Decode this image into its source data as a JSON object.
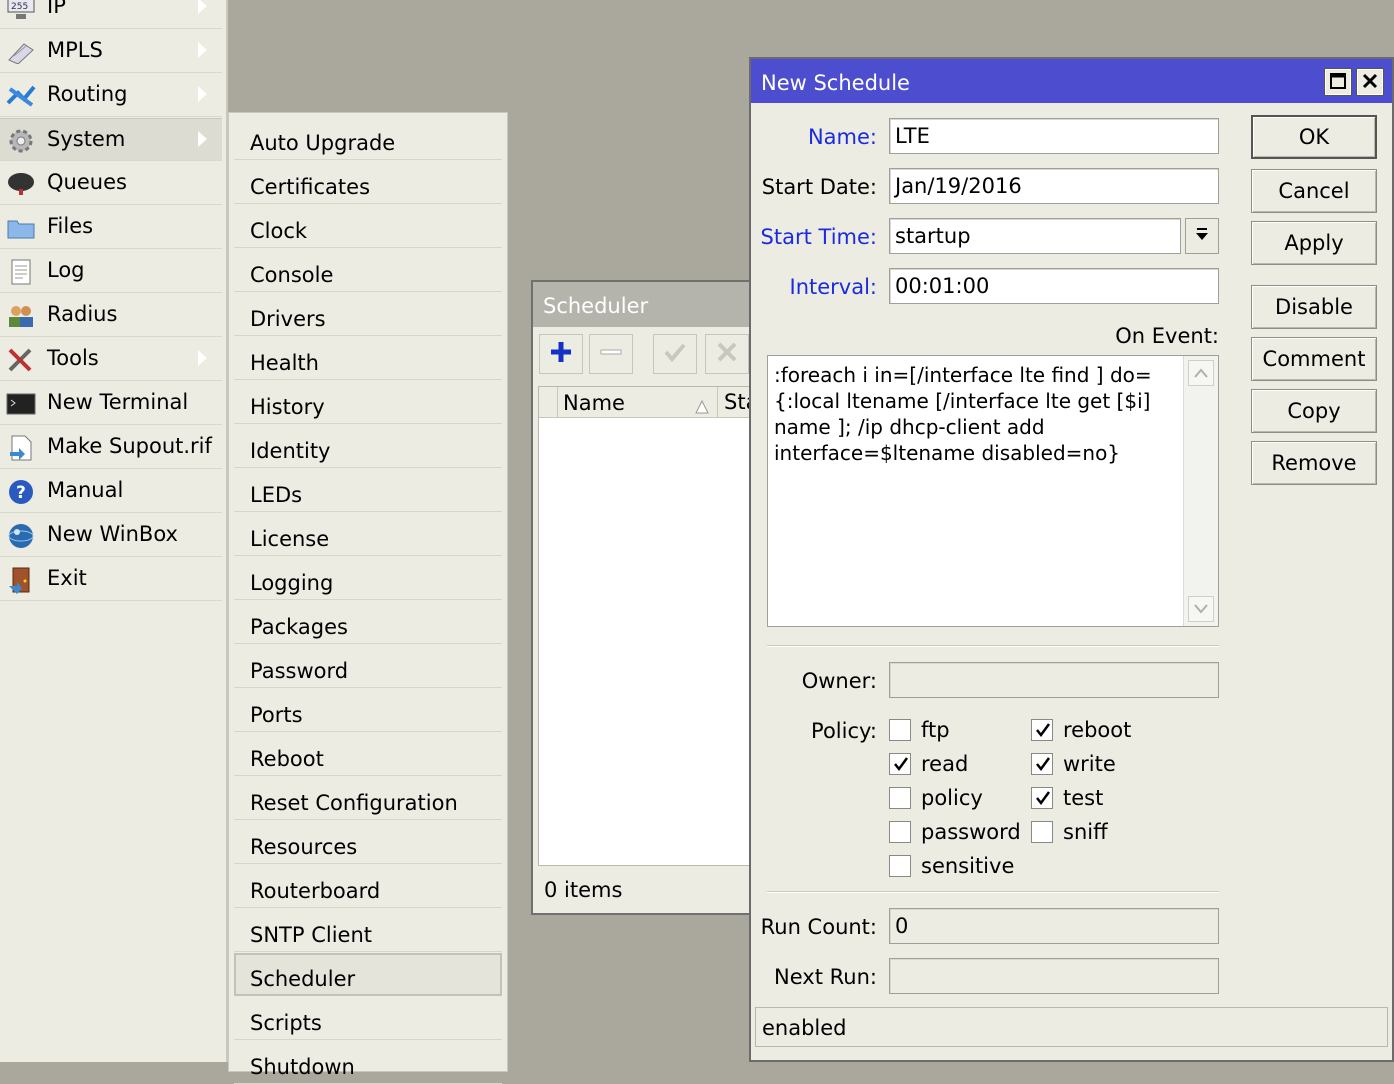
{
  "main_menu": {
    "items": [
      {
        "label": "IP",
        "icon": "ip-icon",
        "submenu": true
      },
      {
        "label": "MPLS",
        "icon": "mpls-icon",
        "submenu": true
      },
      {
        "label": "Routing",
        "icon": "routing-icon",
        "submenu": true
      },
      {
        "label": "System",
        "icon": "gear-icon",
        "submenu": true
      },
      {
        "label": "Queues",
        "icon": "queues-icon",
        "submenu": false
      },
      {
        "label": "Files",
        "icon": "folder-icon",
        "submenu": false
      },
      {
        "label": "Log",
        "icon": "log-icon",
        "submenu": false
      },
      {
        "label": "Radius",
        "icon": "users-icon",
        "submenu": false
      },
      {
        "label": "Tools",
        "icon": "tools-icon",
        "submenu": true
      },
      {
        "label": "New Terminal",
        "icon": "terminal-icon",
        "submenu": false
      },
      {
        "label": "Make Supout.rif",
        "icon": "document-icon",
        "submenu": false
      },
      {
        "label": "Manual",
        "icon": "help-icon",
        "submenu": false
      },
      {
        "label": "New WinBox",
        "icon": "winbox-icon",
        "submenu": false
      },
      {
        "label": "Exit",
        "icon": "exit-door-icon",
        "submenu": false
      }
    ]
  },
  "system_submenu": {
    "items": [
      "Auto Upgrade",
      "Certificates",
      "Clock",
      "Console",
      "Drivers",
      "Health",
      "History",
      "Identity",
      "LEDs",
      "License",
      "Logging",
      "Packages",
      "Password",
      "Ports",
      "Reboot",
      "Reset Configuration",
      "Resources",
      "Routerboard",
      "SNTP Client",
      "Scheduler",
      "Scripts",
      "Shutdown"
    ],
    "selected": "Scheduler"
  },
  "scheduler": {
    "title": "Scheduler",
    "column_name": "Name",
    "column_start": "Sta",
    "status": "0 items"
  },
  "new_schedule": {
    "title": "New Schedule",
    "name_label": "Name:",
    "name_value": "LTE",
    "start_date_label": "Start Date:",
    "start_date_value": "Jan/19/2016",
    "start_time_label": "Start Time:",
    "start_time_value": "startup",
    "interval_label": "Interval:",
    "interval_value": "00:01:00",
    "on_event_label": "On Event:",
    "on_event_value": ":foreach i in=[/interface lte find ] do={:local ltename [/interface lte get [$i] name ]; /ip dhcp-client add interface=$ltename disabled=no}",
    "owner_label": "Owner:",
    "owner_value": "",
    "policy_label": "Policy:",
    "policies": [
      {
        "label": "ftp",
        "checked": false
      },
      {
        "label": "reboot",
        "checked": true
      },
      {
        "label": "read",
        "checked": true
      },
      {
        "label": "write",
        "checked": true
      },
      {
        "label": "policy",
        "checked": false
      },
      {
        "label": "test",
        "checked": true
      },
      {
        "label": "password",
        "checked": false
      },
      {
        "label": "sniff",
        "checked": false
      },
      {
        "label": "sensitive",
        "checked": false
      }
    ],
    "run_count_label": "Run Count:",
    "run_count_value": "0",
    "next_run_label": "Next Run:",
    "next_run_value": "",
    "status": "enabled",
    "buttons": {
      "ok": "OK",
      "cancel": "Cancel",
      "apply": "Apply",
      "disable": "Disable",
      "comment": "Comment",
      "copy": "Copy",
      "remove": "Remove"
    }
  },
  "colors": {
    "title_active": "#4d4dd0",
    "title_inactive": "#b4b4ac",
    "label_blue": "#1a2be0",
    "desktop": "#aaa89c",
    "panel": "#ecece3"
  }
}
